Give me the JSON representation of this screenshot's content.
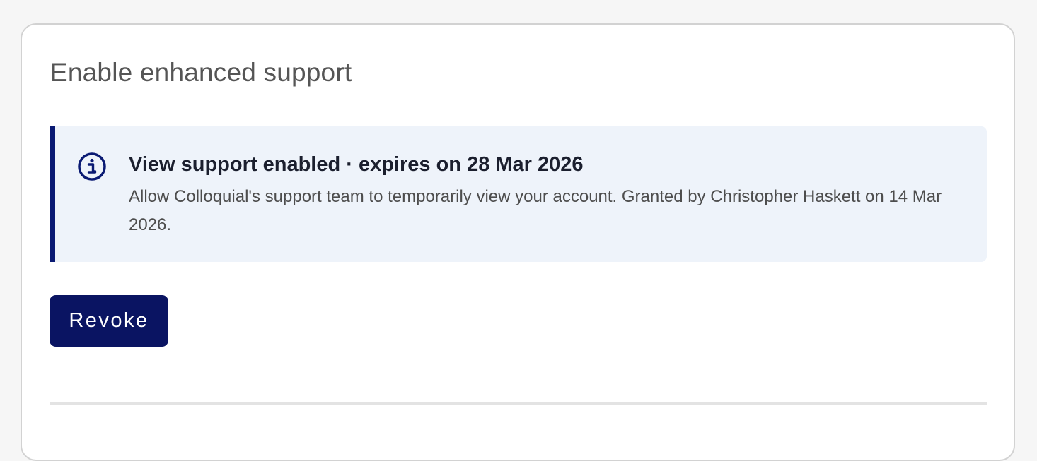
{
  "card": {
    "title": "Enable enhanced support"
  },
  "notice": {
    "icon": "info-circle-icon",
    "title": "View support enabled · expires on 28 Mar 2026",
    "body": "Allow Colloquial's support team to temporarily view your account. Granted by Christopher Haskett on 14 Mar 2026.",
    "accent_color": "#0a1a73",
    "background_color": "#eef3fa"
  },
  "actions": {
    "revoke_label": "Revoke",
    "revoke_color": "#0a1462"
  }
}
